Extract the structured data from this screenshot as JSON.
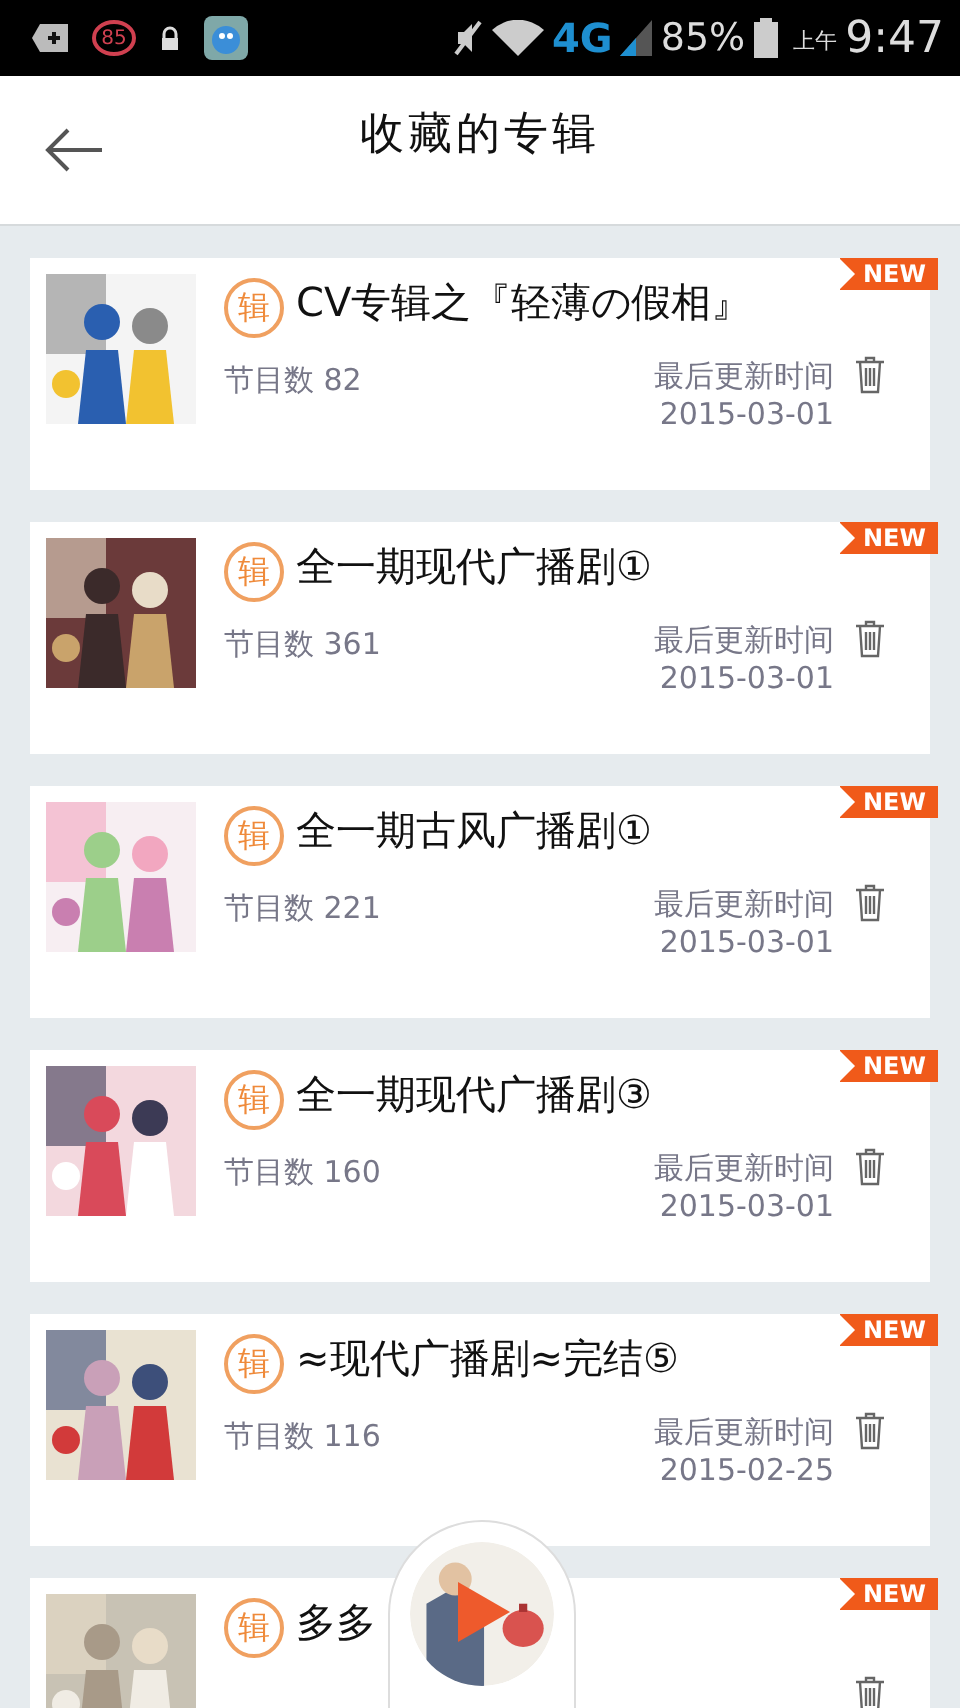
{
  "status_bar": {
    "heart_badge": "85",
    "network": "4G",
    "battery": "85%",
    "time_period": "上午",
    "time": "9:47"
  },
  "header": {
    "title": "收藏的专辑"
  },
  "albums": [
    {
      "badge": "辑",
      "title": "CV专辑之『轻薄の假相』",
      "count": "节目数 82",
      "updated_label": "最后更新时间",
      "updated": "2015-03-01",
      "tag": "NEW"
    },
    {
      "badge": "辑",
      "title": "全一期现代广播剧①",
      "count": "节目数 361",
      "updated_label": "最后更新时间",
      "updated": "2015-03-01",
      "tag": "NEW"
    },
    {
      "badge": "辑",
      "title": "全一期古风广播剧①",
      "count": "节目数 221",
      "updated_label": "最后更新时间",
      "updated": "2015-03-01",
      "tag": "NEW"
    },
    {
      "badge": "辑",
      "title": "全一期现代广播剧③",
      "count": "节目数 160",
      "updated_label": "最后更新时间",
      "updated": "2015-03-01",
      "tag": "NEW"
    },
    {
      "badge": "辑",
      "title": "≈现代广播剧≈完结⑤",
      "count": "节目数 116",
      "updated_label": "最后更新时间",
      "updated": "2015-02-25",
      "tag": "NEW"
    },
    {
      "badge": "辑",
      "title": "多多",
      "tag": "NEW"
    }
  ]
}
